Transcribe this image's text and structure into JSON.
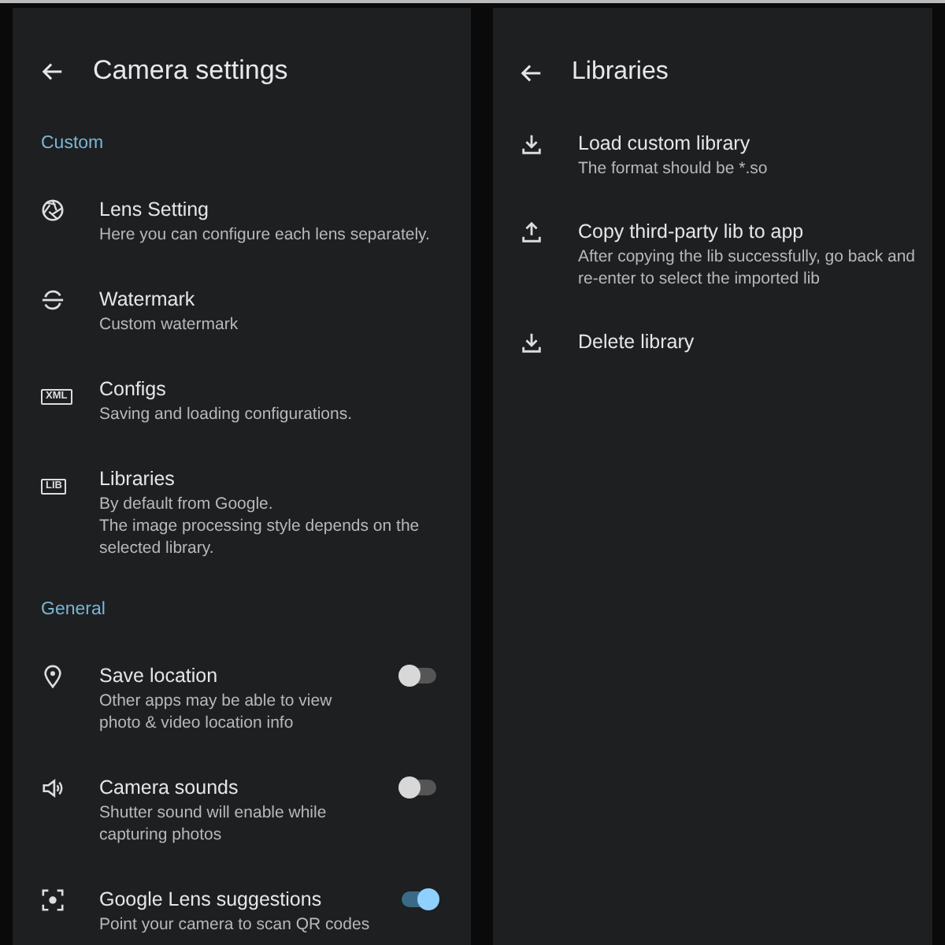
{
  "settings_screen": {
    "title": "Camera settings",
    "sections": [
      {
        "header": "Custom",
        "items": [
          {
            "kind": "link",
            "title": "Lens Setting",
            "subtitle": "Here you can configure each lens separately."
          },
          {
            "kind": "link",
            "title": "Watermark",
            "subtitle": "Custom watermark"
          },
          {
            "kind": "link",
            "badge": "XML",
            "title": "Configs",
            "subtitle": "Saving and loading configurations."
          },
          {
            "kind": "link",
            "badge": "LIB",
            "title": "Libraries",
            "subtitle": "By default from Google.\nThe image processing style depends on the selected library."
          }
        ]
      },
      {
        "header": "General",
        "items": [
          {
            "kind": "toggle",
            "title": "Save location",
            "subtitle": "Other apps may be able to view\nphoto & video location info",
            "on": false
          },
          {
            "kind": "toggle",
            "title": "Camera sounds",
            "subtitle": "Shutter sound will enable while\ncapturing photos",
            "on": false
          },
          {
            "kind": "toggle",
            "title": "Google Lens suggestions",
            "subtitle": "Point your camera to scan QR codes",
            "on": true
          }
        ]
      }
    ]
  },
  "libraries_screen": {
    "title": "Libraries",
    "items": [
      {
        "title": "Load custom library",
        "subtitle": "The format should be *.so"
      },
      {
        "title": "Copy third-party lib to app",
        "subtitle": "After copying the lib successfully, go back and\nre-enter to select the imported lib"
      },
      {
        "title": "Delete library"
      }
    ]
  }
}
